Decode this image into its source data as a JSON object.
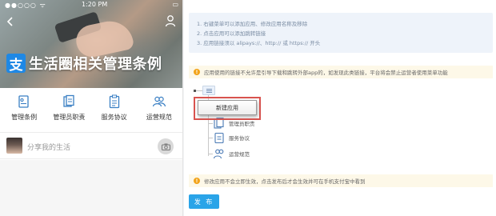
{
  "phone": {
    "status": {
      "signal": "●●○○○ ᯤ",
      "time": "1:20 PM",
      "battery": "▭"
    },
    "hero_title": "生活圈相关管理条例",
    "hero_logo": "支",
    "menu": [
      {
        "label": "管理条例",
        "icon": "rules-icon"
      },
      {
        "label": "管理员职责",
        "icon": "admin-duty-icon"
      },
      {
        "label": "服务协议",
        "icon": "service-agreement-icon"
      },
      {
        "label": "运营规范",
        "icon": "operation-norms-icon"
      }
    ],
    "share_placeholder": "分享我的生活"
  },
  "editor": {
    "tips": [
      "1. 右键菜单可以添加应用、修改应用名称及移除",
      "2. 点击应用可以添加跳转链接",
      "3. 应用链接须以 alipays://、http:// 或 https:// 开头"
    ],
    "notice_top": "应用使用的链接不允许是引导下载和跳转外部app的，如发现此类链接，平台将会禁止运营者使用菜单功能",
    "context_menu_item": "新建应用",
    "tree_nodes": [
      "管理员职责",
      "服务协议",
      "运营规范"
    ],
    "notice_bottom": "修改应用不会立即生效，点击发布后才会生效并可在手机支付宝中看到",
    "publish_label": "发 布"
  },
  "colors": {
    "brand_blue": "#1e88e5",
    "publish_blue": "#2aa4e8",
    "warning_orange": "#f2a31a",
    "highlight_red": "#d9534f"
  }
}
